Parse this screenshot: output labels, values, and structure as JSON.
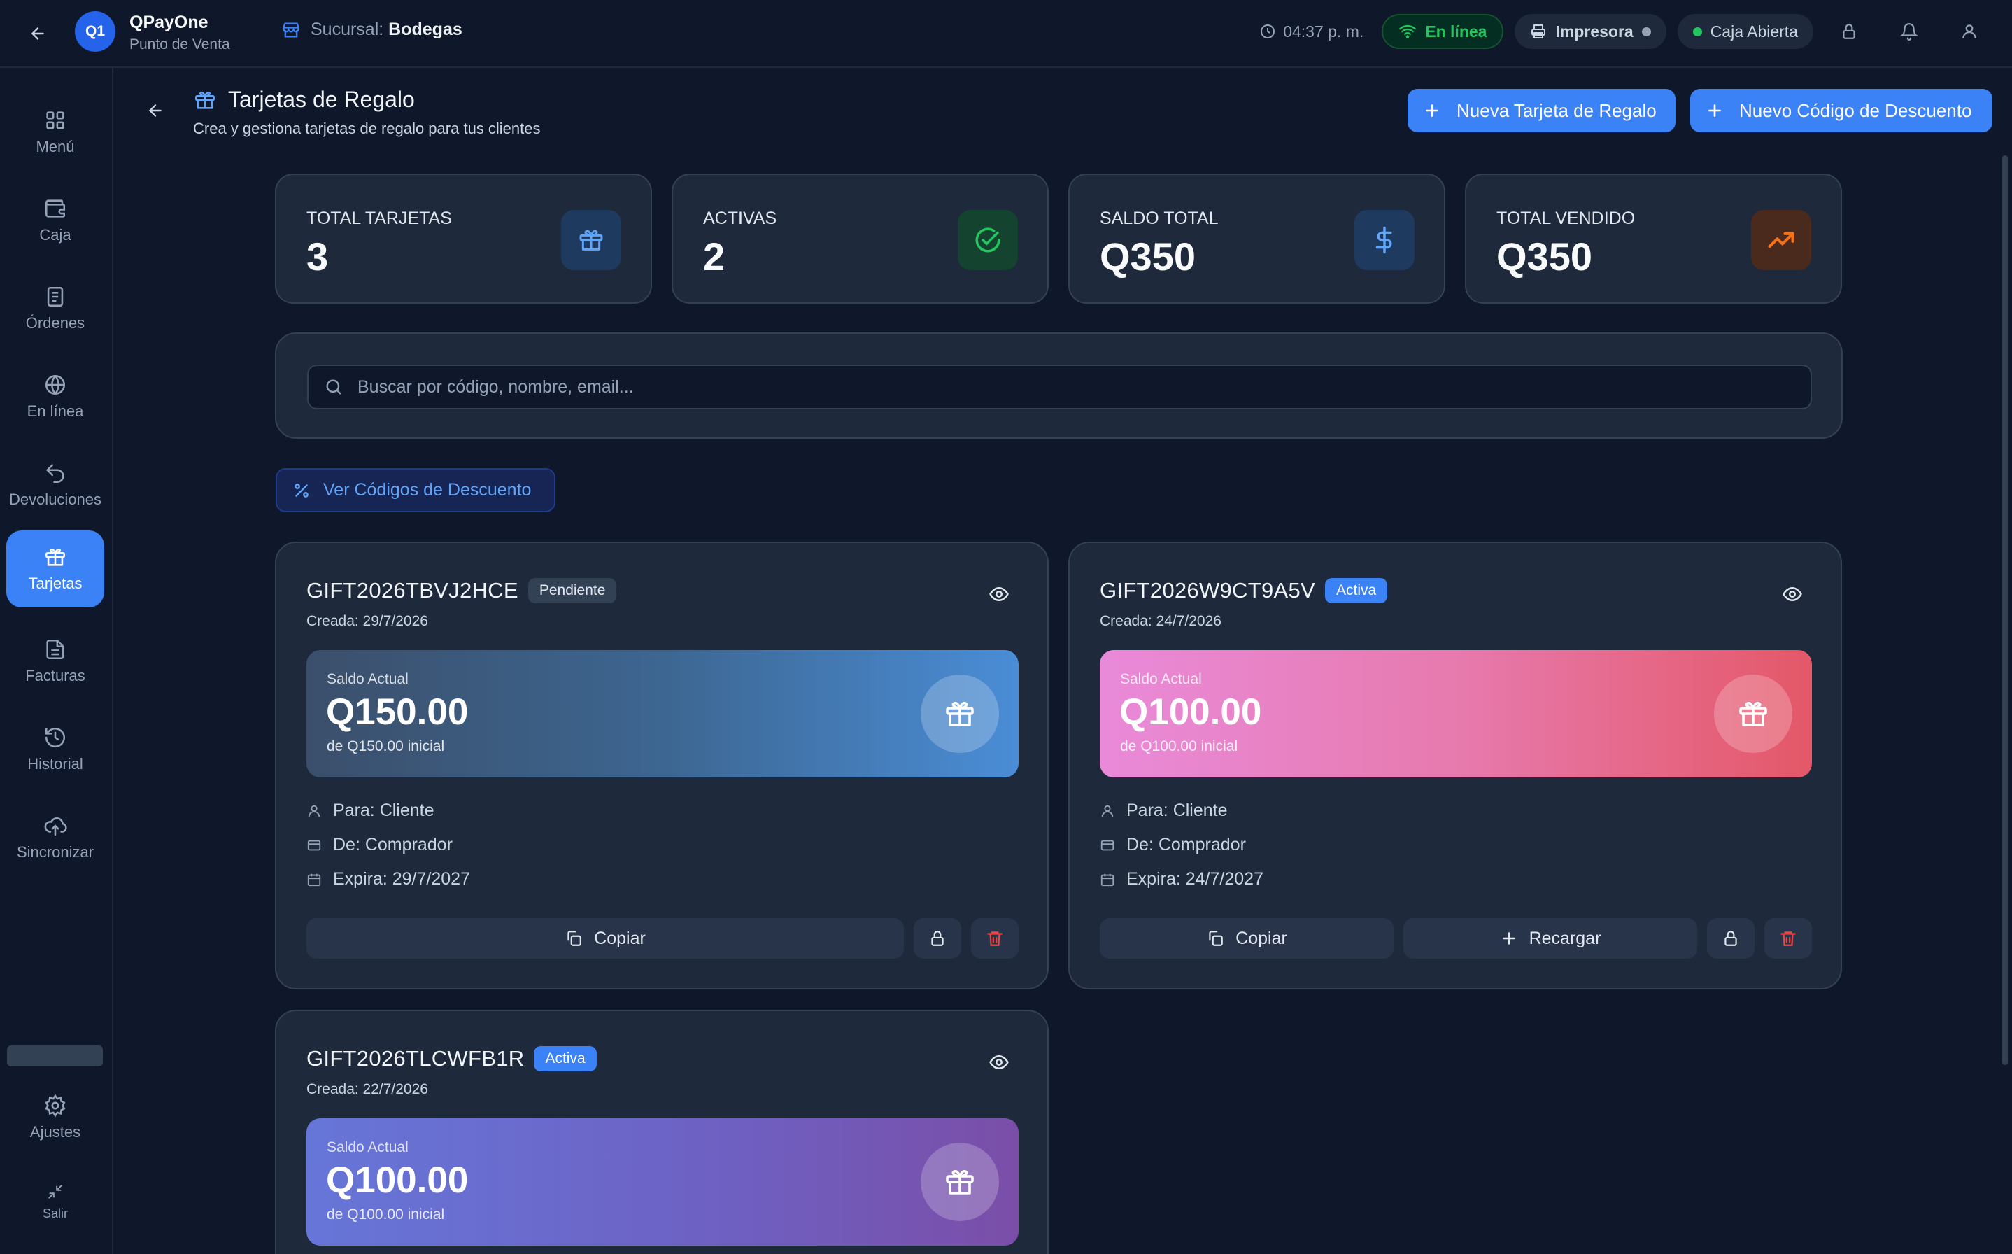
{
  "topbar": {
    "app_name": "QPayOne",
    "app_sub": "Punto de Venta",
    "logo_text": "Q1",
    "branch_label": "Sucursal:",
    "branch_name": "Bodegas",
    "time": "04:37 p. m.",
    "online_label": "En línea",
    "printer_label": "Impresora",
    "cash_label": "Caja Abierta"
  },
  "sidebar": {
    "items": [
      {
        "label": "Menú",
        "icon": "grid-icon"
      },
      {
        "label": "Caja",
        "icon": "wallet-icon"
      },
      {
        "label": "Órdenes",
        "icon": "receipt-icon"
      },
      {
        "label": "En línea",
        "icon": "globe-icon"
      },
      {
        "label": "Devoluciones",
        "icon": "undo-icon"
      },
      {
        "label": "Tarjetas",
        "icon": "gift-icon"
      },
      {
        "label": "Facturas",
        "icon": "document-icon"
      },
      {
        "label": "Historial",
        "icon": "history-icon"
      },
      {
        "label": "Sincronizar",
        "icon": "cloud-upload-icon"
      }
    ],
    "settings_label": "Ajustes",
    "exit_label": "Salir"
  },
  "page": {
    "title": "Tarjetas de Regalo",
    "subtitle": "Crea y gestiona tarjetas de regalo para tus clientes",
    "new_gift_button": "Nueva Tarjeta de Regalo",
    "new_discount_button": "Nuevo Código de Descuento"
  },
  "stats": [
    {
      "label": "TOTAL TARJETAS",
      "value": "3",
      "icon": "gift-icon",
      "color": "#60a5fa"
    },
    {
      "label": "ACTIVAS",
      "value": "2",
      "icon": "check-circle-icon",
      "color": "#22c55e"
    },
    {
      "label": "SALDO TOTAL",
      "value": "Q350",
      "icon": "dollar-icon",
      "color": "#60a5fa"
    },
    {
      "label": "TOTAL VENDIDO",
      "value": "Q350",
      "icon": "trending-up-icon",
      "color": "#f97316"
    }
  ],
  "search": {
    "placeholder": "Buscar por código, nombre, email...",
    "value": ""
  },
  "discount_link": "Ver Códigos de Descuento",
  "cards": [
    {
      "code": "GIFT2026TBVJ2HCE",
      "status": "Pendiente",
      "created": "Creada: 29/7/2026",
      "balance_label": "Saldo Actual",
      "balance": "Q150.00",
      "initial": "de Q150.00 inicial",
      "to": "Para: Cliente",
      "from": "De: Comprador",
      "expires": "Expira: 29/7/2027",
      "copy_label": "Copiar"
    },
    {
      "code": "GIFT2026W9CT9A5V",
      "status": "Activa",
      "created": "Creada: 24/7/2026",
      "balance_label": "Saldo Actual",
      "balance": "Q100.00",
      "initial": "de Q100.00 inicial",
      "to": "Para: Cliente",
      "from": "De: Comprador",
      "expires": "Expira: 24/7/2027",
      "copy_label": "Copiar",
      "reload_label": "Recargar"
    },
    {
      "code": "GIFT2026TLCWFB1R",
      "status": "Activa",
      "created": "Creada: 22/7/2026",
      "balance_label": "Saldo Actual",
      "balance": "Q100.00",
      "initial": "de Q100.00 inicial"
    }
  ],
  "colors": {
    "accent": "#3b82f6",
    "background": "#0f172a",
    "card": "#1e293b",
    "online": "#22c55e",
    "danger": "#ef4444"
  }
}
